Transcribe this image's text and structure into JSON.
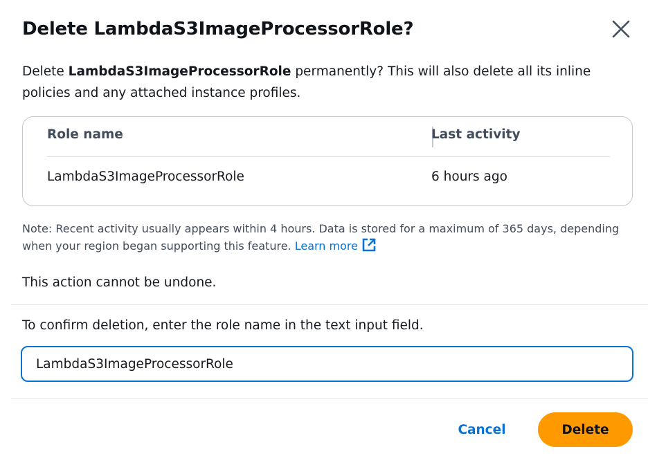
{
  "modal": {
    "title": "Delete LambdaS3ImageProcessorRole?",
    "close_icon": "close-icon"
  },
  "intro": {
    "prefix": "Delete ",
    "role_name": "LambdaS3ImageProcessorRole",
    "suffix": " permanently? This will also delete all its inline policies and any attached instance profiles."
  },
  "table": {
    "columns": [
      "Role name",
      "Last activity"
    ],
    "rows": [
      {
        "role_name": "LambdaS3ImageProcessorRole",
        "last_activity": "6 hours ago"
      }
    ]
  },
  "note": {
    "text": "Note: Recent activity usually appears within 4 hours. Data is stored for a maximum of 365 days, depending when your region began supporting this feature. ",
    "link_label": "Learn more",
    "link_icon": "external-link-icon"
  },
  "warning": "This action cannot be undone.",
  "confirm": {
    "label": "To confirm deletion, enter the role name in the text input field.",
    "value": "LambdaS3ImageProcessorRole"
  },
  "footer": {
    "cancel_label": "Cancel",
    "delete_label": "Delete"
  },
  "colors": {
    "accent": "#0972d3",
    "primary_button": "#ff9900"
  }
}
